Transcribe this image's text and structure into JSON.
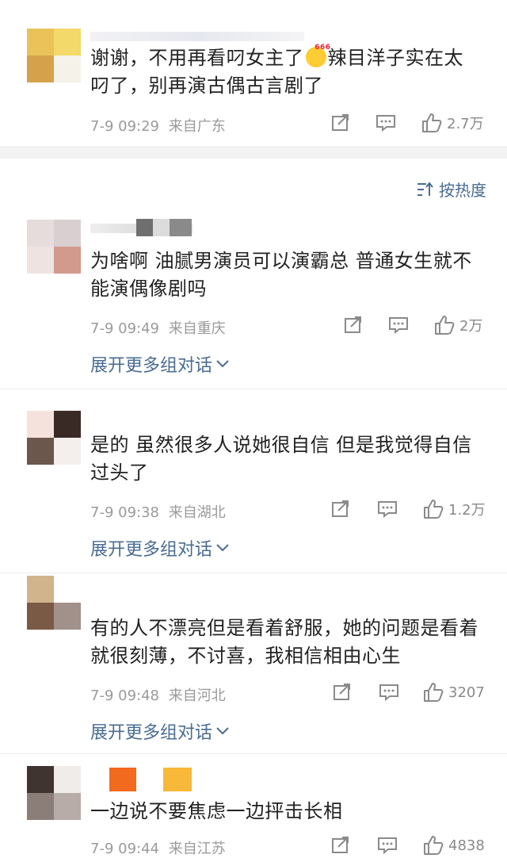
{
  "sort_label": "按热度",
  "comments": [
    {
      "text_lines": [
        "谢谢，不用再看叼女主了",
        "辣目洋子实在太",
        "叼了，别再演古偶古言剧了"
      ],
      "emoji": "666",
      "time": "7-9 09:29",
      "location": "来自广东",
      "likes": "2.7万",
      "expand": ""
    },
    {
      "text_lines": [
        "为啥啊 油腻男演员可以演霸总 普通女生就不",
        "能演偶像剧吗"
      ],
      "time": "7-9 09:49",
      "location": "来自重庆",
      "likes": "2万",
      "expand": "展开更多组对话"
    },
    {
      "text_lines": [
        "是的 虽然很多人说她很自信 但是我觉得自信",
        "过头了"
      ],
      "time": "7-9 09:38",
      "location": "来自湖北",
      "likes": "1.2万",
      "expand": "展开更多组对话"
    },
    {
      "text_lines": [
        "有的人不漂亮但是看着舒服，她的问题是看着",
        "就很刻薄，不讨喜，我相信相由心生"
      ],
      "time": "7-9 09:48",
      "location": "来自河北",
      "likes": "3207",
      "expand": "展开更多组对话"
    },
    {
      "text_lines": [
        "一边说不要焦虑一边抨击长相"
      ],
      "time": "7-9 09:44",
      "location": "来自江苏",
      "likes": "4838",
      "expand": ""
    }
  ],
  "icons": {
    "share": "share-icon",
    "comment": "comment-icon",
    "like": "thumbs-up-icon",
    "sort": "sort-icon",
    "chevron": "chevron-down-icon"
  },
  "colors": {
    "link": "#4a6c92",
    "meta": "#9a9a9a",
    "divider": "#ececec"
  }
}
